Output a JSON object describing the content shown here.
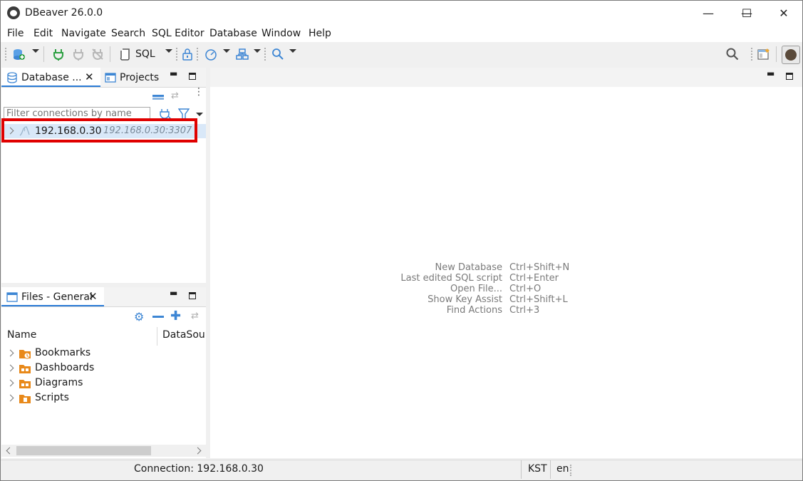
{
  "window": {
    "title": "DBeaver 26.0.0",
    "minimize_glyph": "—",
    "maximize_glyph": "☐",
    "close_glyph": "✕"
  },
  "menu": [
    "File",
    "Edit",
    "Navigate",
    "Search",
    "SQL Editor",
    "Database",
    "Window",
    "Help"
  ],
  "toolbar": {
    "sql_label": "SQL",
    "icons": [
      "new-connection-icon",
      "connect-icon",
      "disconnect-icon",
      "invalidate-icon",
      "sql-editor-icon",
      "transaction-lock-icon",
      "dashboard-icon",
      "schema-compare-icon",
      "search-icon",
      "global-search-icon",
      "perspective-icon",
      "avatar-icon"
    ]
  },
  "db_navigator": {
    "tab_label": "Database ...",
    "projects_tab_label": "Projects",
    "filter_placeholder": "Filter connections by name",
    "connection": {
      "name": "192.168.0.30",
      "detail": "192.168.0.30:3307"
    }
  },
  "files_panel": {
    "tab_label": "Files - General",
    "columns": [
      "Name",
      "DataSource"
    ],
    "items": [
      {
        "label": "Bookmarks",
        "icon": "bookmarks-folder-icon"
      },
      {
        "label": "Dashboards",
        "icon": "dashboards-folder-icon"
      },
      {
        "label": "Diagrams",
        "icon": "diagrams-folder-icon"
      },
      {
        "label": "Scripts",
        "icon": "scripts-folder-icon"
      }
    ]
  },
  "editor_hints": [
    {
      "action": "New Database",
      "shortcut": "Ctrl+Shift+N"
    },
    {
      "action": "Last edited SQL script",
      "shortcut": "Ctrl+Enter"
    },
    {
      "action": "Open File...",
      "shortcut": "Ctrl+O"
    },
    {
      "action": "Show Key Assist",
      "shortcut": "Ctrl+Shift+L"
    },
    {
      "action": "Find Actions",
      "shortcut": "Ctrl+3"
    }
  ],
  "statusbar": {
    "connection": "Connection: 192.168.0.30",
    "timezone": "KST",
    "locale": "en"
  },
  "colors": {
    "accent": "#2a7bd6",
    "selection": "#d9e8f8",
    "highlight_box": "#e00000",
    "folder_orange": "#e8891a"
  }
}
